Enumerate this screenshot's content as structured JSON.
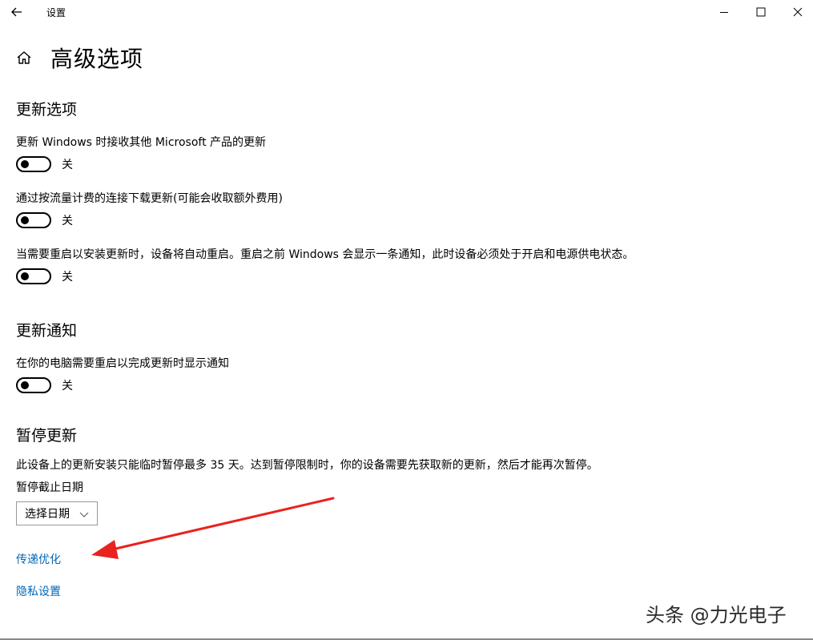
{
  "window": {
    "title": "设置"
  },
  "page": {
    "title": "高级选项"
  },
  "sections": {
    "update_options": {
      "title": "更新选项",
      "items": [
        {
          "label": "更新 Windows 时接收其他 Microsoft 产品的更新",
          "state": "关"
        },
        {
          "label": "通过按流量计费的连接下载更新(可能会收取额外费用)",
          "state": "关"
        },
        {
          "label": "当需要重启以安装更新时，设备将自动重启。重启之前 Windows 会显示一条通知，此时设备必须处于开启和电源供电状态。",
          "state": "关"
        }
      ]
    },
    "update_notifications": {
      "title": "更新通知",
      "items": [
        {
          "label": "在你的电脑需要重启以完成更新时显示通知",
          "state": "关"
        }
      ]
    },
    "pause_updates": {
      "title": "暂停更新",
      "description": "此设备上的更新安装只能临时暂停最多 35 天。达到暂停限制时，你的设备需要先获取新的更新，然后才能再次暂停。",
      "date_label": "暂停截止日期",
      "date_select": "选择日期"
    }
  },
  "links": {
    "delivery_optimization": "传递优化",
    "privacy_settings": "隐私设置"
  },
  "watermark": "头条 @力光电子",
  "colors": {
    "link": "#0067b8",
    "annotation_arrow": "#e8231f"
  }
}
